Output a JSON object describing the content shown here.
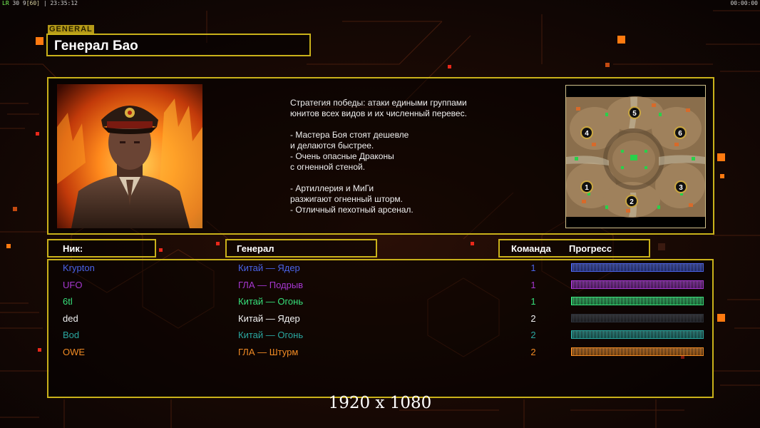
{
  "hud": {
    "left_label": "LR",
    "left_numbers": "30 9",
    "left_bracket": "[60]",
    "clock": "23:35:12",
    "right_timer": "00:00:00"
  },
  "general": {
    "tag": "GENERAL",
    "name": "Генерал Бао",
    "description": [
      "Стратегия победы: атаки едиными группами",
      "юнитов всех видов и их численный перевес.",
      "",
      "- Мастера Боя стоят дешевле",
      "и делаются быстрее.",
      "- Очень опасные Драконы",
      "с огненной стеной.",
      "",
      "- Артиллерия и МиГи",
      "разжигают огненный шторм.",
      "- Отличный пехотный арсенал."
    ],
    "map_spawns": [
      "1",
      "2",
      "3",
      "4",
      "5",
      "6"
    ]
  },
  "table": {
    "col_nick": "Ник:",
    "col_general": "Генерал",
    "col_team": "Команда",
    "col_progress": "Прогресс"
  },
  "players": [
    {
      "nick": "Krypton",
      "general": "Китай — Ядер",
      "team": "1",
      "color": "#4a63e8",
      "progress": 1.0
    },
    {
      "nick": "UFO",
      "general": "ГЛА — Подрыв",
      "team": "1",
      "color": "#a637d0",
      "progress": 1.0
    },
    {
      "nick": "6tl",
      "general": "Китай — Огонь",
      "team": "1",
      "color": "#37e07a",
      "progress": 1.0
    },
    {
      "nick": "ded",
      "general": "Китай — Ядер",
      "team": "2",
      "color": "#f2f2f2",
      "progress": 1.0
    },
    {
      "nick": "Bod",
      "general": "Китай — Огонь",
      "team": "2",
      "color": "#2aa7a0",
      "progress": 1.0
    },
    {
      "nick": "OWE",
      "general": "ГЛА — Штурм",
      "team": "2",
      "color": "#f08a24",
      "progress": 1.0
    }
  ],
  "resolution": "1920 x 1080"
}
